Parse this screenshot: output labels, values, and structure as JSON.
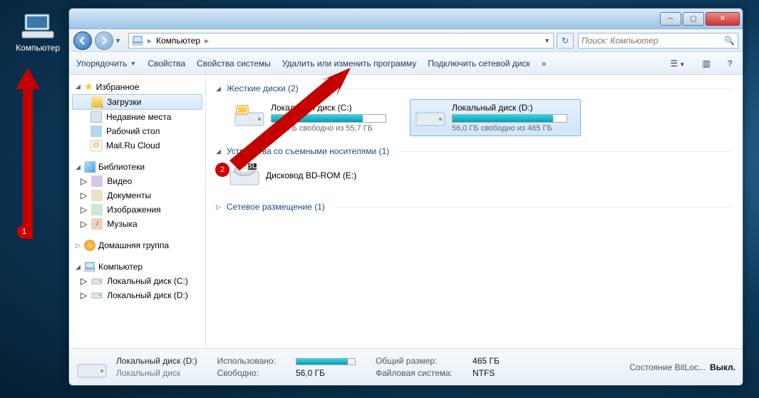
{
  "desktop": {
    "computer_label": "Компьютер"
  },
  "annotations": {
    "n1": "1",
    "n2": "2"
  },
  "titlebar": {},
  "nav": {
    "breadcrumb_root": "Компьютер",
    "search_placeholder": "Поиск: Компьютер"
  },
  "toolbar": {
    "organize": "Упорядочить",
    "properties": "Свойства",
    "sys_properties": "Свойства системы",
    "uninstall": "Удалить или изменить программу",
    "map_drive": "Подключить сетевой диск",
    "more": "»"
  },
  "sidebar": {
    "favorites": "Избранное",
    "downloads": "Загрузки",
    "recent": "Недавние места",
    "desktop": "Рабочий стол",
    "mailru": "Mail.Ru Cloud",
    "libraries": "Библиотеки",
    "video": "Видео",
    "documents": "Документы",
    "pictures": "Изображения",
    "music": "Музыка",
    "homegroup": "Домашняя группа",
    "computer": "Компьютер",
    "disk_c": "Локальный диск (C:)",
    "disk_d": "Локальный диск (D:)"
  },
  "content": {
    "hdd_header": "Жесткие диски (2)",
    "drive_c": {
      "name": "Локальный диск (C:)",
      "sub": "11,0 ГБ свободно из 55,7 ГБ",
      "fill_pct": 80
    },
    "drive_d": {
      "name": "Локальный диск (D:)",
      "sub": "56,0 ГБ свободно из 465 ГБ",
      "fill_pct": 88
    },
    "removable_header": "Устройства со съемными носителями (1)",
    "bdrom": "Дисковод BD-ROM (E:)",
    "network_header": "Сетевое размещение (1)"
  },
  "status": {
    "name": "Локальный диск (D:)",
    "sub": "Локальный диск",
    "used_k": "Использовано:",
    "free_k": "Свободно:",
    "free_v": "56,0 ГБ",
    "total_k": "Общий размер:",
    "total_v": "465 ГБ",
    "fs_k": "Файловая система:",
    "fs_v": "NTFS",
    "bl_k": "Состояние BitLoc...",
    "bl_v": "Выкл.",
    "bar_pct": 88
  }
}
